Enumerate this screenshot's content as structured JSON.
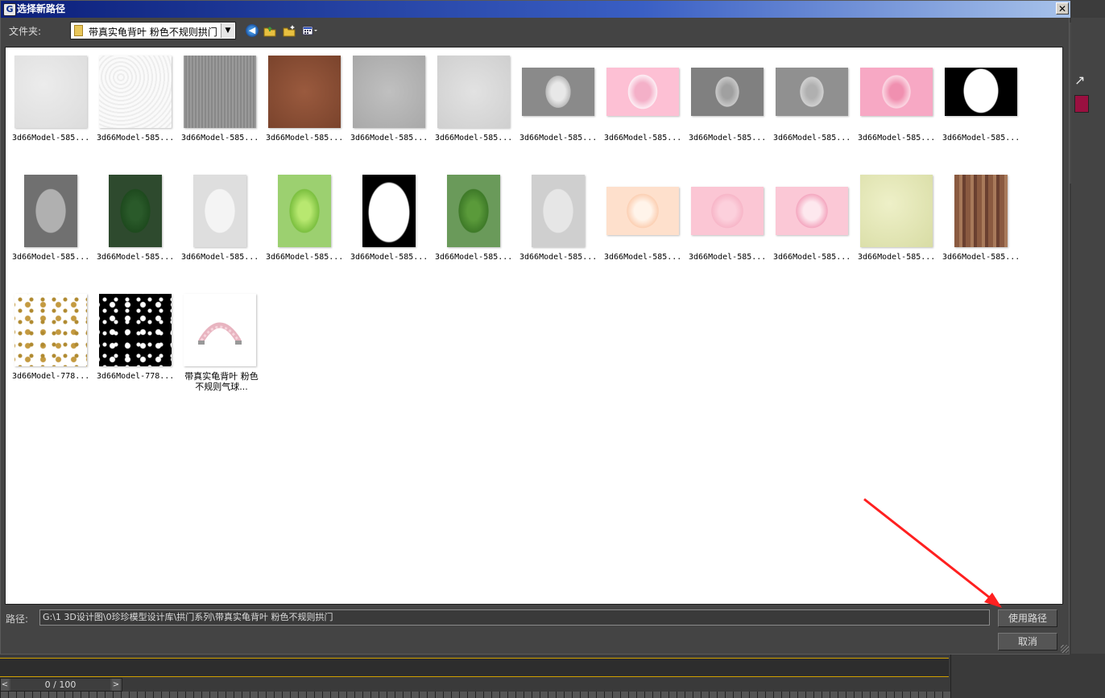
{
  "dialog": {
    "title": "选择新路径",
    "folder_label": "文件夹:",
    "folder_value": "带真实龟背叶 粉色不规则拱门",
    "path_label": "路径:",
    "path_value": "G:\\1 3D设计图\\0珍珍模型设计库\\拱门系列\\带真实龟背叶 粉色不规则拱门",
    "use_path_button": "使用路径",
    "cancel_button": "取消",
    "close_glyph": "✕"
  },
  "toolbar": {
    "back_icon": "back-arrow-icon",
    "up_icon": "up-folder-icon",
    "new_folder_icon": "new-folder-icon",
    "view_menu_icon": "view-menu-icon"
  },
  "files": [
    {
      "caption": "3d66Model-585..."
    },
    {
      "caption": "3d66Model-585..."
    },
    {
      "caption": "3d66Model-585..."
    },
    {
      "caption": "3d66Model-585..."
    },
    {
      "caption": "3d66Model-585..."
    },
    {
      "caption": "3d66Model-585..."
    },
    {
      "caption": "3d66Model-585..."
    },
    {
      "caption": "3d66Model-585..."
    },
    {
      "caption": "3d66Model-585..."
    },
    {
      "caption": "3d66Model-585..."
    },
    {
      "caption": "3d66Model-585..."
    },
    {
      "caption": "3d66Model-585..."
    },
    {
      "caption": "3d66Model-585..."
    },
    {
      "caption": "3d66Model-585..."
    },
    {
      "caption": "3d66Model-585..."
    },
    {
      "caption": "3d66Model-585..."
    },
    {
      "caption": "3d66Model-585..."
    },
    {
      "caption": "3d66Model-585..."
    },
    {
      "caption": "3d66Model-585..."
    },
    {
      "caption": "3d66Model-585..."
    },
    {
      "caption": "3d66Model-585..."
    },
    {
      "caption": "3d66Model-585..."
    },
    {
      "caption": "3d66Model-585..."
    },
    {
      "caption": "3d66Model-585..."
    },
    {
      "caption": "3d66Model-778..."
    },
    {
      "caption": "3d66Model-778..."
    },
    {
      "caption": "带真实龟背叶 粉色不规则气球..."
    }
  ],
  "timeline": {
    "frame_label": "0 / 100",
    "left_arrow": "<",
    "right_arrow": ">"
  }
}
